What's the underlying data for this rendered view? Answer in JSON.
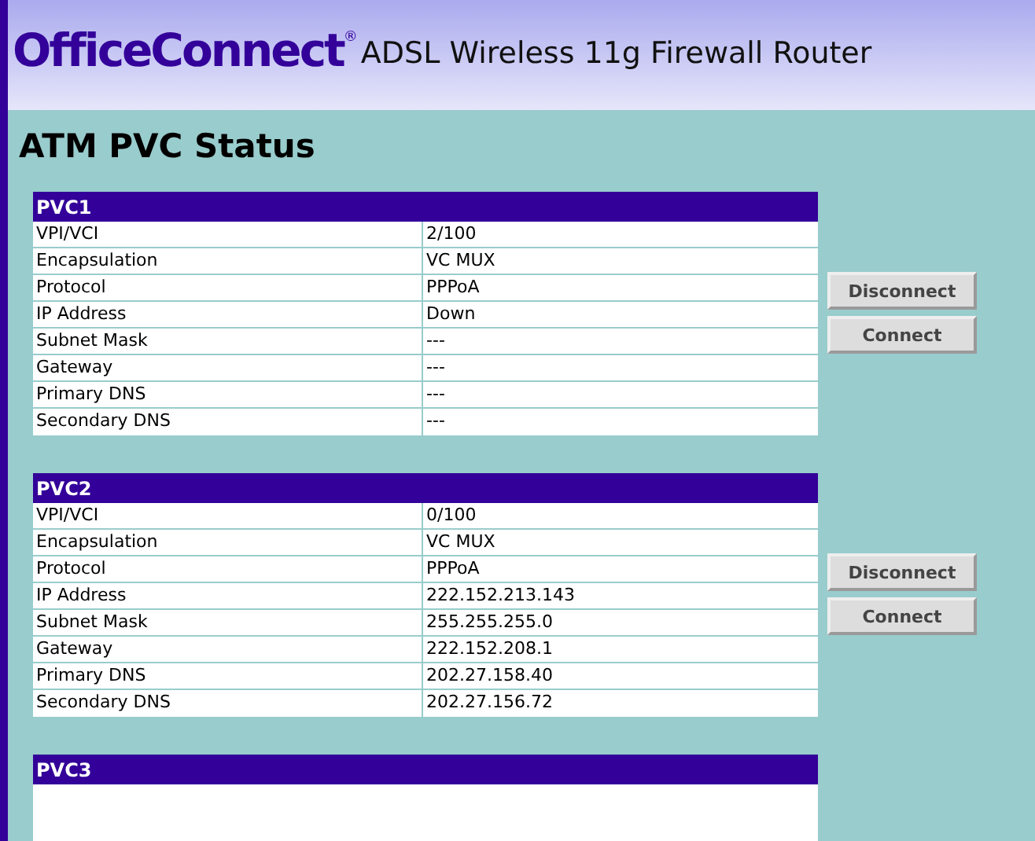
{
  "header": {
    "brand": "OfficeConnect",
    "brand_mark": "®",
    "product": "ADSL Wireless 11g Firewall Router"
  },
  "page_title": "ATM PVC Status",
  "pvcs": [
    {
      "title": "PVC1",
      "rows": [
        {
          "label": "VPI/VCI",
          "value": "2/100"
        },
        {
          "label": "Encapsulation",
          "value": "VC MUX"
        },
        {
          "label": "Protocol",
          "value": "PPPoA"
        },
        {
          "label": "IP Address",
          "value": "Down"
        },
        {
          "label": "Subnet Mask",
          "value": "---"
        },
        {
          "label": "Gateway",
          "value": "---"
        },
        {
          "label": "Primary DNS",
          "value": "---"
        },
        {
          "label": "Secondary DNS",
          "value": "---"
        }
      ],
      "buttons": [
        "Disconnect",
        "Connect"
      ]
    },
    {
      "title": "PVC2",
      "rows": [
        {
          "label": "VPI/VCI",
          "value": "0/100"
        },
        {
          "label": "Encapsulation",
          "value": "VC MUX"
        },
        {
          "label": "Protocol",
          "value": "PPPoA"
        },
        {
          "label": "IP Address",
          "value": "222.152.213.143"
        },
        {
          "label": "Subnet Mask",
          "value": "255.255.255.0"
        },
        {
          "label": "Gateway",
          "value": "222.152.208.1"
        },
        {
          "label": "Primary DNS",
          "value": "202.27.158.40"
        },
        {
          "label": "Secondary DNS",
          "value": "202.27.156.72"
        }
      ],
      "buttons": [
        "Disconnect",
        "Connect"
      ]
    },
    {
      "title": "PVC3"
    }
  ]
}
